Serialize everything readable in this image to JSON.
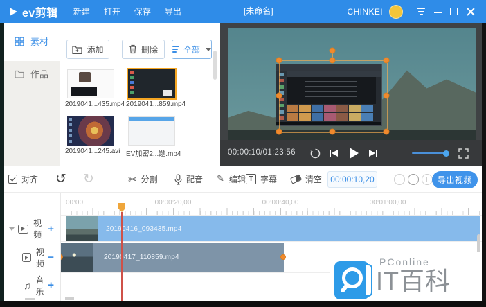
{
  "titlebar": {
    "logo": "ev剪辑",
    "menu": {
      "new": "新建",
      "open": "打开",
      "save": "保存",
      "export": "导出"
    },
    "project": "[未命名]",
    "user": "CHINKEI"
  },
  "sidebar": {
    "material": "素材",
    "works": "作品"
  },
  "library": {
    "add": "添加",
    "delete": "删除",
    "filter": "全部",
    "items": [
      {
        "name": "2019041...435.mp4"
      },
      {
        "name": "2019041...859.mp4"
      },
      {
        "name": "2019041...245.avi"
      },
      {
        "name": "EV加密2...题.mp4"
      }
    ]
  },
  "preview": {
    "timecode": "00:00:10/01:23:56"
  },
  "toolbar": {
    "align": "对齐",
    "split": "分割",
    "dub": "配音",
    "edit": "编辑",
    "subtitle": "字幕",
    "subtitle_icon_letter": "T",
    "clear": "清空",
    "timecode": "00:00:10,20",
    "export": "导出视频"
  },
  "timeline": {
    "ruler": [
      "00:00",
      "00:00:20,00",
      "00:00:40,00",
      "00:01:00,00"
    ],
    "tracks": [
      {
        "type": "video",
        "label": "视频",
        "action": "+",
        "clip": "20190416_093435.mp4"
      },
      {
        "type": "video",
        "label": "视频",
        "action": "−",
        "clip": "20190417_110859.mp4"
      },
      {
        "type": "music",
        "label": "音乐",
        "action": "+"
      }
    ]
  },
  "watermark": {
    "brand": "PConline",
    "title": "IT百科"
  },
  "icons": {
    "scissors": "✂",
    "undo": "↺",
    "redo": "↻",
    "pencil": "✎",
    "music_note": "♫"
  },
  "colors": {
    "titlebar_blue": "#2F8CE8",
    "accent_blue": "#3A8EE6",
    "selection_orange": "#F5A623",
    "clip_video1": "#86BAEB",
    "clip_video2": "#7E94A8",
    "playhead": "#EFA63B",
    "playhead_line": "#CF5148",
    "avatar_yellow": "#F3C53A"
  }
}
